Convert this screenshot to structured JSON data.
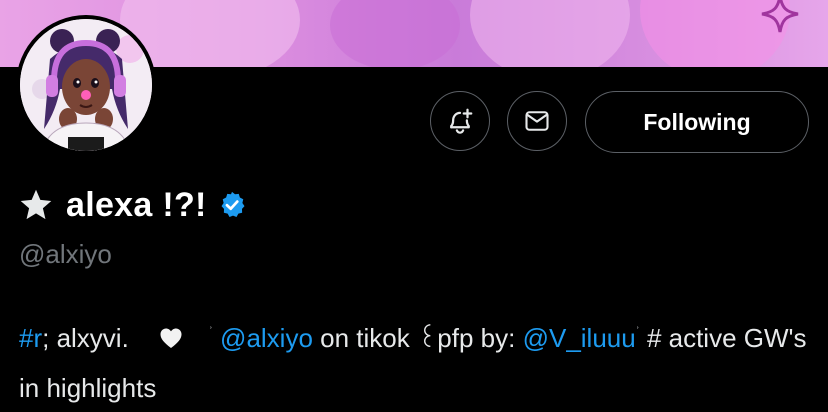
{
  "profile": {
    "display_name": "alexa !?!",
    "handle": "@alxiyo",
    "verified": true,
    "star_icon": "star-icon",
    "verified_icon": "verified-badge-icon"
  },
  "actions": {
    "notify_icon": "bell-plus-icon",
    "message_icon": "envelope-icon",
    "follow_label": "Following"
  },
  "bio": {
    "tag": "#r",
    "text1": "; alxyvi.",
    "heart_icon": "heart-icon",
    "sparkle1": "ʾ",
    "mention1": "@alxiyo",
    "text2": " on tikok ",
    "glyph": "꒰",
    "text3": "pfp by: ",
    "mention2": "@V_iluuu",
    "sparkle2": "ʾ",
    "text4": " # active GW's in highlights"
  },
  "colors": {
    "accent": "#1d9bf0",
    "muted": "#71767b",
    "background": "#000000",
    "banner": "#dd8fe0"
  }
}
